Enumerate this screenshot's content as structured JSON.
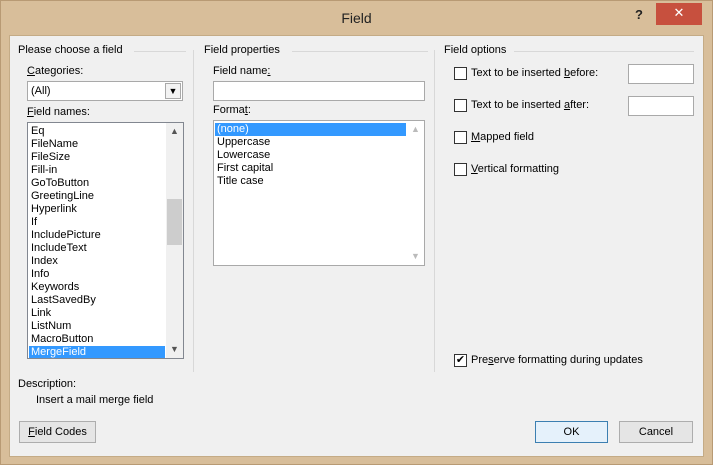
{
  "window": {
    "title": "Field",
    "help_glyph": "?",
    "close_glyph": "✕"
  },
  "left": {
    "group_title": "Please choose a field",
    "categories_label_pre": "",
    "categories_label_key": "C",
    "categories_label_post": "ategories:",
    "categories_value": "(All)",
    "field_names_label_key": "F",
    "field_names_label_post": "ield names:",
    "field_names": [
      "Eq",
      "FileName",
      "FileSize",
      "Fill-in",
      "GoToButton",
      "GreetingLine",
      "Hyperlink",
      "If",
      "IncludePicture",
      "IncludeText",
      "Index",
      "Info",
      "Keywords",
      "LastSavedBy",
      "Link",
      "ListNum",
      "MacroButton",
      "MergeField"
    ],
    "selected_field": "MergeField"
  },
  "middle": {
    "group_title": "Field properties",
    "field_name_label_pre": "Field name",
    "field_name_label_key": ":",
    "field_name_value": "",
    "format_label_pre": "Forma",
    "format_label_key": "t",
    "format_label_post": ":",
    "formats": [
      "(none)",
      "Uppercase",
      "Lowercase",
      "First capital",
      "Title case"
    ],
    "selected_format": "(none)"
  },
  "right": {
    "group_title": "Field options",
    "opt_before_pre": "Text to be inserted ",
    "opt_before_key": "b",
    "opt_before_post": "efore:",
    "opt_after_pre": "Text to be inserted ",
    "opt_after_key": "a",
    "opt_after_post": "fter:",
    "opt_mapped_key": "M",
    "opt_mapped_post": "apped field",
    "opt_vertical_key": "V",
    "opt_vertical_post": "ertical formatting",
    "opt_preserve_pre": "Pre",
    "opt_preserve_key": "s",
    "opt_preserve_post": "erve formatting during updates",
    "check_glyph": "✔"
  },
  "description": {
    "label": "Description:",
    "text": "Insert a mail merge field"
  },
  "buttons": {
    "field_codes_key": "F",
    "field_codes_post": "ield Codes",
    "ok": "OK",
    "cancel": "Cancel"
  }
}
